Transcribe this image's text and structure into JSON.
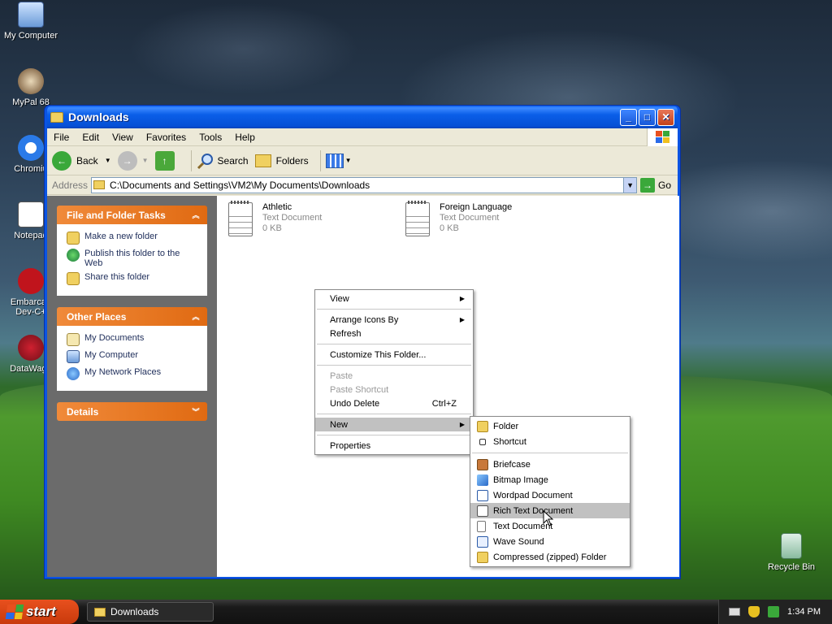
{
  "desktop": {
    "icons": [
      {
        "label": "My Computer"
      },
      {
        "label": "MyPal 68"
      },
      {
        "label": "Chromiu"
      },
      {
        "label": "Notepad"
      },
      {
        "label": "Embarcad Dev-C+"
      },
      {
        "label": "DataWago"
      },
      {
        "label": "Recycle Bin"
      }
    ]
  },
  "window": {
    "title": "Downloads",
    "buttons": {
      "minimize": "_",
      "maximize": "□",
      "close": "✕"
    }
  },
  "menubar": [
    "File",
    "Edit",
    "View",
    "Favorites",
    "Tools",
    "Help"
  ],
  "toolbar": {
    "back": "Back",
    "search": "Search",
    "folders": "Folders"
  },
  "address": {
    "label": "Address",
    "path": "C:\\Documents and Settings\\VM2\\My Documents\\Downloads",
    "go": "Go"
  },
  "taskpane": {
    "file_tasks": {
      "title": "File and Folder Tasks",
      "items": [
        "Make a new folder",
        "Publish this folder to the Web",
        "Share this folder"
      ]
    },
    "other_places": {
      "title": "Other Places",
      "items": [
        "My Documents",
        "My Computer",
        "My Network Places"
      ]
    },
    "details": {
      "title": "Details"
    }
  },
  "files": [
    {
      "name": "Athletic",
      "type": "Text Document",
      "size": "0 KB"
    },
    {
      "name": "Foreign Language",
      "type": "Text Document",
      "size": "0 KB"
    }
  ],
  "context_menu": {
    "view": "View",
    "arrange": "Arrange Icons By",
    "refresh": "Refresh",
    "customize": "Customize This Folder...",
    "paste": "Paste",
    "paste_shortcut": "Paste Shortcut",
    "undo": "Undo Delete",
    "undo_shortcut": "Ctrl+Z",
    "new": "New",
    "properties": "Properties"
  },
  "new_submenu": {
    "folder": "Folder",
    "shortcut": "Shortcut",
    "briefcase": "Briefcase",
    "bitmap": "Bitmap Image",
    "wordpad": "Wordpad Document",
    "rtf": "Rich Text Document",
    "text": "Text Document",
    "wave": "Wave Sound",
    "zip": "Compressed (zipped) Folder"
  },
  "taskbar": {
    "start": "start",
    "task": "Downloads",
    "clock": "1:34 PM"
  },
  "colors": {
    "titlebar": "#0a5ee8",
    "panel_head": "#e06a12",
    "highlight": "#c1c1c1"
  }
}
